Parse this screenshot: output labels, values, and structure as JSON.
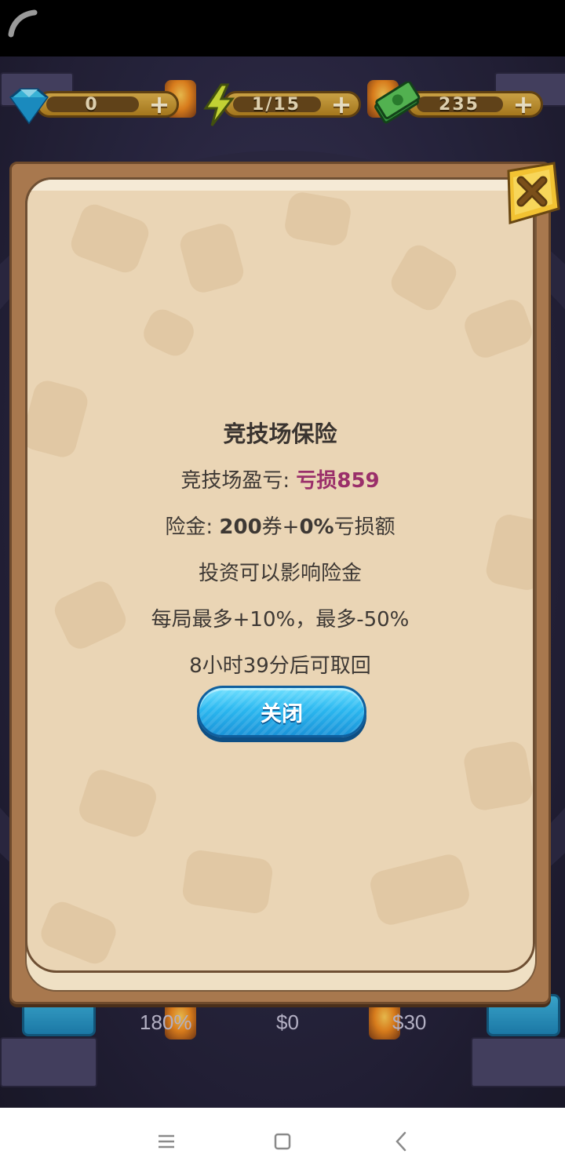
{
  "resources": {
    "gems": {
      "value": "0",
      "icon": "diamond-icon"
    },
    "energy": {
      "value": "1/15",
      "icon": "lightning-icon"
    },
    "cash": {
      "value": "235",
      "icon": "cash-icon"
    },
    "plus": "+"
  },
  "background": {
    "stat_left": "180%",
    "stat_mid": "$0",
    "stat_right": "$30"
  },
  "modal": {
    "title": "竞技场保险",
    "pnl_label": "竞技场盈亏: ",
    "pnl_value": "亏损859",
    "payout_label": "险金: ",
    "payout_amount": "200",
    "payout_unit": "券+",
    "payout_percent": "0%",
    "payout_suffix": "亏损额",
    "note_investment": "投资可以影响险金",
    "note_range": "每局最多+10%，最多-50%",
    "note_time": "8小时39分后可取回",
    "close_button": "关闭"
  },
  "colors": {
    "loss": "#9a2f6a",
    "button": "#2bb8f0",
    "parchment": "#ead5b5"
  },
  "navigation": {
    "menu": "menu-icon",
    "home": "home-icon",
    "back": "back-icon"
  }
}
